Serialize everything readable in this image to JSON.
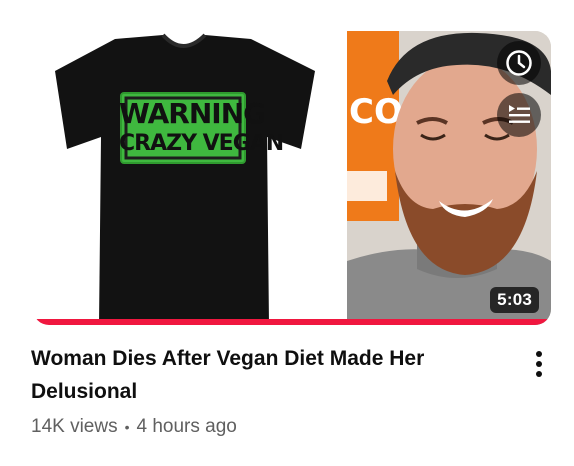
{
  "video": {
    "title": "Woman Dies After Vegan Diet Made Her Delusional",
    "views": "14K views",
    "separator": "•",
    "age": "4 hours ago",
    "duration": "5:03",
    "progress_fraction": 1.0
  },
  "thumbnail": {
    "shirt_text_line1": "WARNING",
    "shirt_text_line2": "CRAZY VEGAN",
    "sign_text": "CO",
    "shirt_color": "#111111",
    "print_color": "#3fb83f",
    "sign_color": "#f07a1a"
  },
  "icons": {
    "watch_later": "clock-icon",
    "add_to_queue": "queue-icon",
    "more_actions": "more-vert-icon"
  },
  "colors": {
    "progress": "#f0173f",
    "title_text": "#0f0f0f",
    "meta_text": "#606060"
  }
}
